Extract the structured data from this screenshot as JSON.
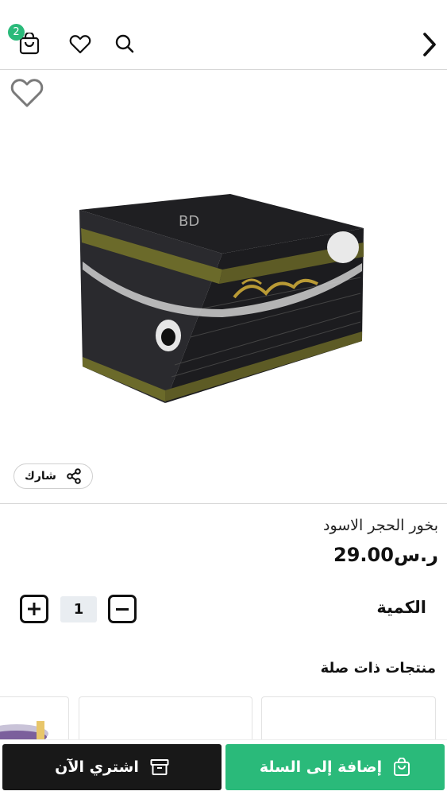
{
  "header": {
    "cart_count": "2",
    "icons": [
      "cart-icon",
      "heart-icon",
      "search-icon",
      "chevron-right-icon"
    ]
  },
  "product": {
    "image_icon": "incense-box-image",
    "share_label": "شارك",
    "title": "بخور الحجر الاسود",
    "price": "ر.س29.00"
  },
  "quantity": {
    "label": "الكمية",
    "value": "1"
  },
  "related": {
    "title": "منتجات ذات صلة"
  },
  "actions": {
    "add_to_cart": "إضافة إلى السلة",
    "buy_now": "اشتري الآن"
  },
  "colors": {
    "accent": "#2aba7a",
    "dark": "#181818"
  }
}
